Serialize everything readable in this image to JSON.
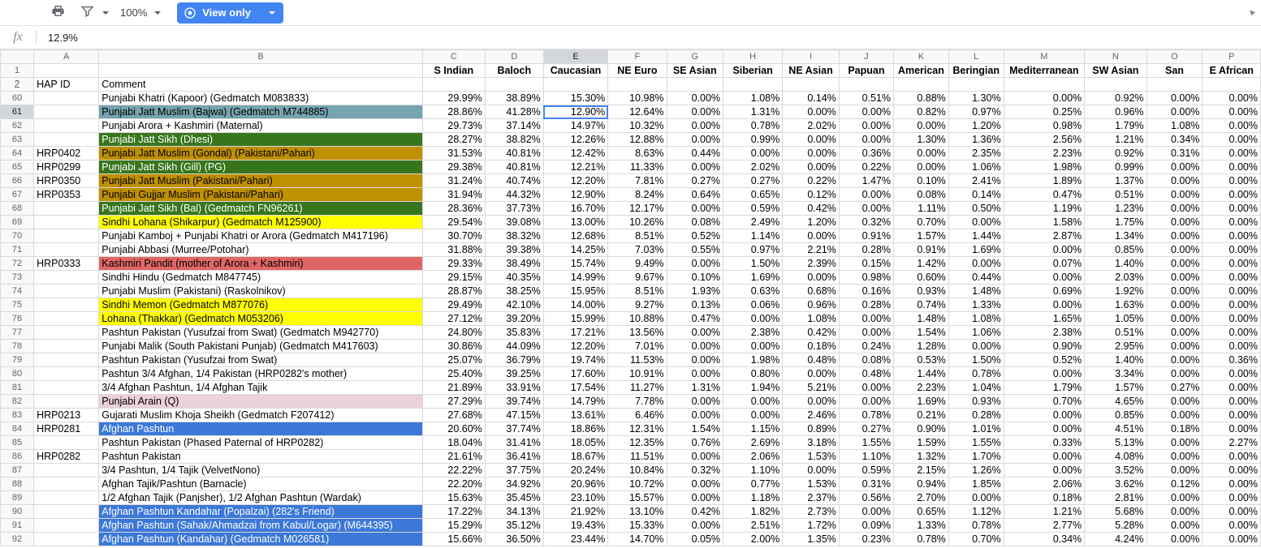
{
  "toolbar": {
    "print_icon": "print-icon",
    "filter_icon": "filter-icon",
    "zoom_value": "100%",
    "view_only_label": "View only",
    "eye_icon": "eye-icon",
    "collapse_icon": "collapse-arrow-icon",
    "accent_color": "#4285f4"
  },
  "formula_bar": {
    "fx_label": "fx",
    "value": "12.9%"
  },
  "grid": {
    "column_letters": [
      "A",
      "B",
      "C",
      "D",
      "E",
      "F",
      "G",
      "H",
      "I",
      "J",
      "K",
      "L",
      "M",
      "N",
      "O",
      "P"
    ],
    "selected_column": "E",
    "selected_row": "61",
    "selected_cell": "E61",
    "header_row_number": "1",
    "labels_row": [
      "",
      "",
      "S Indian",
      "Baloch",
      "Caucasian",
      "NE Euro",
      "SE Asian",
      "Siberian",
      "NE Asian",
      "Papuan",
      "American",
      "Beringian",
      "Mediterranean",
      "SW Asian",
      "San",
      "E African"
    ],
    "hapid_row_number": "2",
    "hapid_row": [
      "HAP ID",
      "Comment"
    ],
    "colors": {
      "teal": "#76a5af",
      "dark_green": "#38761d",
      "dark_yellow": "#bf9000",
      "yellow": "#ffff00",
      "salmon": "#e06666",
      "pink": "#ead1dc",
      "blue": "#3c78d8",
      "white": "#ffffff"
    },
    "rows": [
      {
        "n": "60",
        "a": "",
        "b": "Punjabi Khatri (Kapoor) (Gedmatch M083833)",
        "fill": "white",
        "v": [
          "29.99%",
          "38.89%",
          "15.30%",
          "10.98%",
          "0.00%",
          "1.08%",
          "0.14%",
          "0.51%",
          "0.88%",
          "1.30%",
          "0.00%",
          "0.92%",
          "0.00%",
          "0.00%"
        ]
      },
      {
        "n": "61",
        "a": "",
        "b": "Punjabi Jatt Muslim (Bajwa) (Gedmatch M744885)",
        "fill": "teal",
        "v": [
          "28.86%",
          "41.28%",
          "12.90%",
          "12.64%",
          "0.00%",
          "1.31%",
          "0.00%",
          "0.00%",
          "0.82%",
          "0.97%",
          "0.25%",
          "0.96%",
          "0.00%",
          "0.00%"
        ]
      },
      {
        "n": "62",
        "a": "",
        "b": "Punjabi Arora + Kashmiri (Maternal)",
        "fill": "white",
        "v": [
          "29.73%",
          "37.14%",
          "14.97%",
          "10.32%",
          "0.00%",
          "0.78%",
          "2.02%",
          "0.00%",
          "0.00%",
          "1.20%",
          "0.98%",
          "1.79%",
          "1.08%",
          "0.00%"
        ]
      },
      {
        "n": "63",
        "a": "",
        "b": "Punjabi Jatt Sikh (Dhesi)",
        "fill": "dark_green",
        "v": [
          "28.27%",
          "38.82%",
          "12.26%",
          "12.88%",
          "0.00%",
          "0.99%",
          "0.00%",
          "0.00%",
          "1.30%",
          "1.36%",
          "2.56%",
          "1.21%",
          "0.34%",
          "0.00%"
        ]
      },
      {
        "n": "64",
        "a": "HRP0402",
        "b": "Punjabi Jatt Muslim (Gondal) (Pakistani/Pahari)",
        "fill": "dark_yellow",
        "v": [
          "31.53%",
          "40.81%",
          "12.42%",
          "8.63%",
          "0.44%",
          "0.00%",
          "0.00%",
          "0.36%",
          "0.00%",
          "2.35%",
          "2.23%",
          "0.92%",
          "0.31%",
          "0.00%"
        ]
      },
      {
        "n": "65",
        "a": "HRP0299",
        "b": "Punjabi Jatt Sikh (Gill) (PG)",
        "fill": "dark_green",
        "v": [
          "29.38%",
          "40.81%",
          "12.21%",
          "11.33%",
          "0.00%",
          "2.02%",
          "0.00%",
          "0.22%",
          "0.00%",
          "1.06%",
          "1.98%",
          "0.99%",
          "0.00%",
          "0.00%"
        ]
      },
      {
        "n": "66",
        "a": "HRP0350",
        "b": "Punjabi Jatt Muslim (Pakistani/Pahari)",
        "fill": "dark_yellow",
        "v": [
          "31.24%",
          "40.74%",
          "12.20%",
          "7.81%",
          "0.27%",
          "0.27%",
          "0.22%",
          "1.47%",
          "0.10%",
          "2.41%",
          "1.89%",
          "1.37%",
          "0.00%",
          "0.00%"
        ]
      },
      {
        "n": "67",
        "a": "HRP0353",
        "b": "Punjabi Gujjar Muslim (Pakistani/Pahari)",
        "fill": "dark_yellow",
        "v": [
          "31.94%",
          "44.32%",
          "12.90%",
          "8.24%",
          "0.64%",
          "0.65%",
          "0.12%",
          "0.00%",
          "0.08%",
          "0.14%",
          "0.47%",
          "0.51%",
          "0.00%",
          "0.00%"
        ]
      },
      {
        "n": "68",
        "a": "",
        "b": "Punjabi Jatt Sikh (Bal) (Gedmatch FN96261)",
        "fill": "dark_green",
        "v": [
          "28.36%",
          "37.73%",
          "16.70%",
          "12.17%",
          "0.00%",
          "0.59%",
          "0.42%",
          "0.00%",
          "1.11%",
          "0.50%",
          "1.19%",
          "1.23%",
          "0.00%",
          "0.00%"
        ]
      },
      {
        "n": "69",
        "a": "",
        "b": "Sindhi Lohana (Shikarpur) (Gedmatch M125900)",
        "fill": "yellow",
        "v": [
          "29.54%",
          "39.08%",
          "13.00%",
          "10.26%",
          "0.08%",
          "2.49%",
          "1.20%",
          "0.32%",
          "0.70%",
          "0.00%",
          "1.58%",
          "1.75%",
          "0.00%",
          "0.00%"
        ]
      },
      {
        "n": "70",
        "a": "",
        "b": "Punjabi Kamboj + Punjabi Khatri or Arora (Gedmatch M417196)",
        "fill": "white",
        "v": [
          "30.70%",
          "38.32%",
          "12.68%",
          "8.51%",
          "0.52%",
          "1.14%",
          "0.00%",
          "0.91%",
          "1.57%",
          "1.44%",
          "2.87%",
          "1.34%",
          "0.00%",
          "0.00%"
        ]
      },
      {
        "n": "71",
        "a": "",
        "b": "Punjabi Abbasi (Murree/Potohar)",
        "fill": "white",
        "v": [
          "31.88%",
          "39.38%",
          "14.25%",
          "7.03%",
          "0.55%",
          "0.97%",
          "2.21%",
          "0.28%",
          "0.91%",
          "1.69%",
          "0.00%",
          "0.85%",
          "0.00%",
          "0.00%"
        ]
      },
      {
        "n": "72",
        "a": "HRP0333",
        "b": "Kashmiri Pandit (mother of Arora + Kashmiri)",
        "fill": "salmon",
        "v": [
          "29.33%",
          "38.49%",
          "15.74%",
          "9.49%",
          "0.00%",
          "1.50%",
          "2.39%",
          "0.15%",
          "1.42%",
          "0.00%",
          "0.07%",
          "1.40%",
          "0.00%",
          "0.00%"
        ]
      },
      {
        "n": "73",
        "a": "",
        "b": "Sindhi Hindu (Gedmatch M847745)",
        "fill": "white",
        "v": [
          "29.15%",
          "40.35%",
          "14.99%",
          "9.67%",
          "0.10%",
          "1.69%",
          "0.00%",
          "0.98%",
          "0.60%",
          "0.44%",
          "0.00%",
          "2.03%",
          "0.00%",
          "0.00%"
        ]
      },
      {
        "n": "74",
        "a": "",
        "b": "Punjabi Muslim (Pakistani) (Raskolnikov)",
        "fill": "white",
        "v": [
          "28.87%",
          "38.25%",
          "15.95%",
          "8.51%",
          "1.93%",
          "0.63%",
          "0.68%",
          "0.16%",
          "0.93%",
          "1.48%",
          "0.69%",
          "1.92%",
          "0.00%",
          "0.00%"
        ]
      },
      {
        "n": "75",
        "a": "",
        "b": "Sindhi Memon (Gedmatch M877076)",
        "fill": "yellow",
        "v": [
          "29.49%",
          "42.10%",
          "14.00%",
          "9.27%",
          "0.13%",
          "0.06%",
          "0.96%",
          "0.28%",
          "0.74%",
          "1.33%",
          "0.00%",
          "1.63%",
          "0.00%",
          "0.00%"
        ]
      },
      {
        "n": "76",
        "a": "",
        "b": "Lohana (Thakkar) (Gedmatch M053206)",
        "fill": "yellow",
        "v": [
          "27.12%",
          "39.20%",
          "15.99%",
          "10.88%",
          "0.47%",
          "0.00%",
          "1.08%",
          "0.00%",
          "1.48%",
          "1.08%",
          "1.65%",
          "1.05%",
          "0.00%",
          "0.00%"
        ]
      },
      {
        "n": "77",
        "a": "",
        "b": "Pashtun Pakistan (Yusufzai from Swat) (Gedmatch M942770)",
        "fill": "white",
        "v": [
          "24.80%",
          "35.83%",
          "17.21%",
          "13.56%",
          "0.00%",
          "2.38%",
          "0.42%",
          "0.00%",
          "1.54%",
          "1.06%",
          "2.38%",
          "0.51%",
          "0.00%",
          "0.00%"
        ]
      },
      {
        "n": "78",
        "a": "",
        "b": "Punjabi Malik (South Pakistani Punjab) (Gedmatch M417603)",
        "fill": "white",
        "v": [
          "30.86%",
          "44.09%",
          "12.20%",
          "7.01%",
          "0.00%",
          "0.00%",
          "0.18%",
          "0.24%",
          "1.28%",
          "0.00%",
          "0.90%",
          "2.95%",
          "0.00%",
          "0.00%"
        ]
      },
      {
        "n": "79",
        "a": "",
        "b": "Pashtun Pakistan (Yusufzai from Swat)",
        "fill": "white",
        "v": [
          "25.07%",
          "36.79%",
          "19.74%",
          "11.53%",
          "0.00%",
          "1.98%",
          "0.48%",
          "0.08%",
          "0.53%",
          "1.50%",
          "0.52%",
          "1.40%",
          "0.00%",
          "0.36%"
        ]
      },
      {
        "n": "80",
        "a": "",
        "b": "Pashtun 3/4 Afghan, 1/4 Pakistan (HRP0282's mother)",
        "fill": "white",
        "v": [
          "25.40%",
          "39.25%",
          "17.60%",
          "10.91%",
          "0.00%",
          "0.80%",
          "0.00%",
          "0.48%",
          "1.44%",
          "0.78%",
          "0.00%",
          "3.34%",
          "0.00%",
          "0.00%"
        ]
      },
      {
        "n": "81",
        "a": "",
        "b": "3/4 Afghan Pashtun, 1/4 Afghan Tajik",
        "fill": "white",
        "v": [
          "21.89%",
          "33.91%",
          "17.54%",
          "11.27%",
          "1.31%",
          "1.94%",
          "5.21%",
          "0.00%",
          "2.23%",
          "1.04%",
          "1.79%",
          "1.57%",
          "0.27%",
          "0.00%"
        ]
      },
      {
        "n": "82",
        "a": "",
        "b": "Punjabi Arain (Q)",
        "fill": "pink",
        "v": [
          "27.29%",
          "39.74%",
          "14.79%",
          "7.78%",
          "0.00%",
          "0.00%",
          "0.00%",
          "0.00%",
          "1.69%",
          "0.93%",
          "0.70%",
          "4.65%",
          "0.00%",
          "0.00%"
        ]
      },
      {
        "n": "83",
        "a": "HRP0213",
        "b": "Gujarati Muslim Khoja Sheikh (Gedmatch F207412)",
        "fill": "white",
        "v": [
          "27.68%",
          "47.15%",
          "13.61%",
          "6.46%",
          "0.00%",
          "0.00%",
          "2.46%",
          "0.78%",
          "0.21%",
          "0.28%",
          "0.00%",
          "0.85%",
          "0.00%",
          "0.00%"
        ]
      },
      {
        "n": "84",
        "a": "HRP0281",
        "b": "Afghan Pashtun",
        "fill": "blue",
        "v": [
          "20.60%",
          "37.74%",
          "18.86%",
          "12.31%",
          "1.54%",
          "1.15%",
          "0.89%",
          "0.27%",
          "0.90%",
          "1.01%",
          "0.00%",
          "4.51%",
          "0.18%",
          "0.00%"
        ]
      },
      {
        "n": "85",
        "a": "",
        "b": "Pashtun Pakistan (Phased Paternal of HRP0282)",
        "fill": "white",
        "v": [
          "18.04%",
          "31.41%",
          "18.05%",
          "12.35%",
          "0.76%",
          "2.69%",
          "3.18%",
          "1.55%",
          "1.59%",
          "1.55%",
          "0.33%",
          "5.13%",
          "0.00%",
          "2.27%"
        ]
      },
      {
        "n": "86",
        "a": "HRP0282",
        "b": "Pashtun Pakistan",
        "fill": "white",
        "v": [
          "21.61%",
          "36.41%",
          "18.67%",
          "11.51%",
          "0.00%",
          "2.06%",
          "1.53%",
          "1.10%",
          "1.32%",
          "1.70%",
          "0.00%",
          "4.08%",
          "0.00%",
          "0.00%"
        ]
      },
      {
        "n": "87",
        "a": "",
        "b": "3/4 Pashtun, 1/4 Tajik (VelvetNono)",
        "fill": "white",
        "v": [
          "22.22%",
          "37.75%",
          "20.24%",
          "10.84%",
          "0.32%",
          "1.10%",
          "0.00%",
          "0.59%",
          "2.15%",
          "1.26%",
          "0.00%",
          "3.52%",
          "0.00%",
          "0.00%"
        ]
      },
      {
        "n": "88",
        "a": "",
        "b": "Afghan Tajik/Pashtun (Barnacle)",
        "fill": "white",
        "v": [
          "22.20%",
          "34.92%",
          "20.96%",
          "10.72%",
          "0.00%",
          "0.77%",
          "1.53%",
          "0.31%",
          "0.94%",
          "1.85%",
          "2.06%",
          "3.62%",
          "0.12%",
          "0.00%"
        ]
      },
      {
        "n": "89",
        "a": "",
        "b": "1/2 Afghan Tajik (Panjsher), 1/2 Afghan Pashtun (Wardak)",
        "fill": "white",
        "v": [
          "15.63%",
          "35.45%",
          "23.10%",
          "15.57%",
          "0.00%",
          "1.18%",
          "2.37%",
          "0.56%",
          "2.70%",
          "0.00%",
          "0.18%",
          "2.81%",
          "0.00%",
          "0.00%"
        ]
      },
      {
        "n": "90",
        "a": "",
        "b": "Afghan Pashtun Kandahar (Popalzai) (282's Friend)",
        "fill": "blue",
        "v": [
          "17.22%",
          "34.13%",
          "21.92%",
          "13.10%",
          "0.42%",
          "1.82%",
          "2.73%",
          "0.00%",
          "0.65%",
          "1.12%",
          "1.21%",
          "5.68%",
          "0.00%",
          "0.00%"
        ]
      },
      {
        "n": "91",
        "a": "",
        "b": "Afghan Pashtun (Sahak/Ahmadzai from Kabul/Logar) (M644395)",
        "fill": "blue",
        "v": [
          "15.29%",
          "35.12%",
          "19.43%",
          "15.33%",
          "0.00%",
          "2.51%",
          "1.72%",
          "0.09%",
          "1.33%",
          "0.78%",
          "2.77%",
          "5.28%",
          "0.00%",
          "0.00%"
        ]
      },
      {
        "n": "92",
        "a": "",
        "b": "Afghan Pashtun (Kandahar) (Gedmatch M026581)",
        "fill": "blue",
        "v": [
          "15.66%",
          "36.50%",
          "23.44%",
          "14.70%",
          "0.05%",
          "2.00%",
          "1.35%",
          "0.23%",
          "0.78%",
          "0.70%",
          "0.34%",
          "4.24%",
          "0.00%",
          "0.00%"
        ]
      }
    ]
  }
}
